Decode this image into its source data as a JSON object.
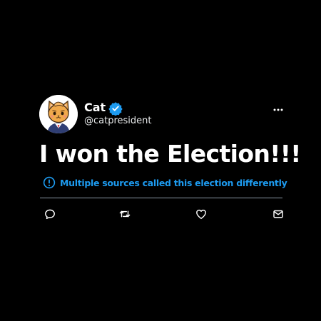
{
  "user": {
    "display_name": "Cat",
    "handle": "@catpresident",
    "verified_badge_color": "#1d9bf0",
    "avatar_icon": "cat-avatar"
  },
  "tweet": {
    "text": "I won the Election!!!"
  },
  "notice": {
    "icon": "info-circle-icon",
    "text": "Multiple sources called this election differently",
    "color": "#1d9bf0"
  },
  "actions": [
    {
      "icon": "reply-icon"
    },
    {
      "icon": "retweet-icon"
    },
    {
      "icon": "like-icon"
    },
    {
      "icon": "share-icon"
    }
  ],
  "menu": {
    "icon": "more-options-icon"
  },
  "colors": {
    "background": "#000000",
    "text": "#ffffff",
    "accent": "#1d9bf0"
  }
}
